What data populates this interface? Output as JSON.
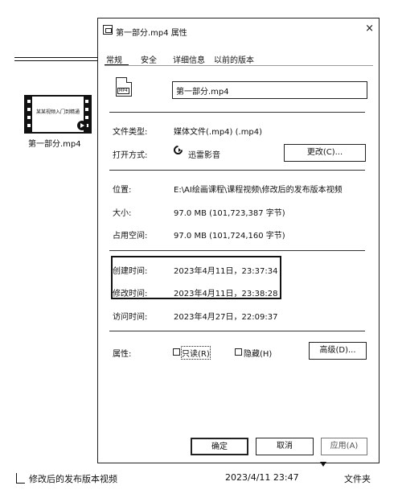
{
  "desktop": {
    "file_label": "第一部分.mp4",
    "thumb_text": "某某视频入门到精通"
  },
  "dialog": {
    "title": "第一部分.mp4 属性",
    "close_glyph": "×",
    "tabs": [
      "常规",
      "安全",
      "详细信息",
      "以前的版本"
    ],
    "filename": "第一部分.mp4",
    "file_icon_tag": "MP4",
    "type_label": "文件类型:",
    "type_value": "媒体文件(.mp4) (.mp4)",
    "open_label": "打开方式:",
    "open_value": "迅雷影音",
    "change_button": "更改(C)...",
    "location_label": "位置:",
    "location_value": "E:\\AI绘画课程\\课程视频\\修改后的发布版本视频",
    "size_label": "大小:",
    "size_value": "97.0 MB (101,723,387 字节)",
    "disk_label": "占用空间:",
    "disk_value": "97.0 MB (101,724,160 字节)",
    "created_label": "创建时间:",
    "created_value": "2023年4月11日，23:37:34",
    "modified_label": "修改时间:",
    "modified_value": "2023年4月11日，23:38:28",
    "accessed_label": "访问时间:",
    "accessed_value": "2023年4月27日，22:09:37",
    "attr_label": "属性:",
    "readonly_label": "只读(R)",
    "hidden_label": "隐藏(H)",
    "advanced_button": "高级(D)...",
    "ok_button": "确定",
    "cancel_button": "取消",
    "apply_button": "应用(A)"
  },
  "explorer_row": {
    "name": "修改后的发布版本视频",
    "date": "2023/4/11 23:47",
    "type": "文件夹"
  }
}
